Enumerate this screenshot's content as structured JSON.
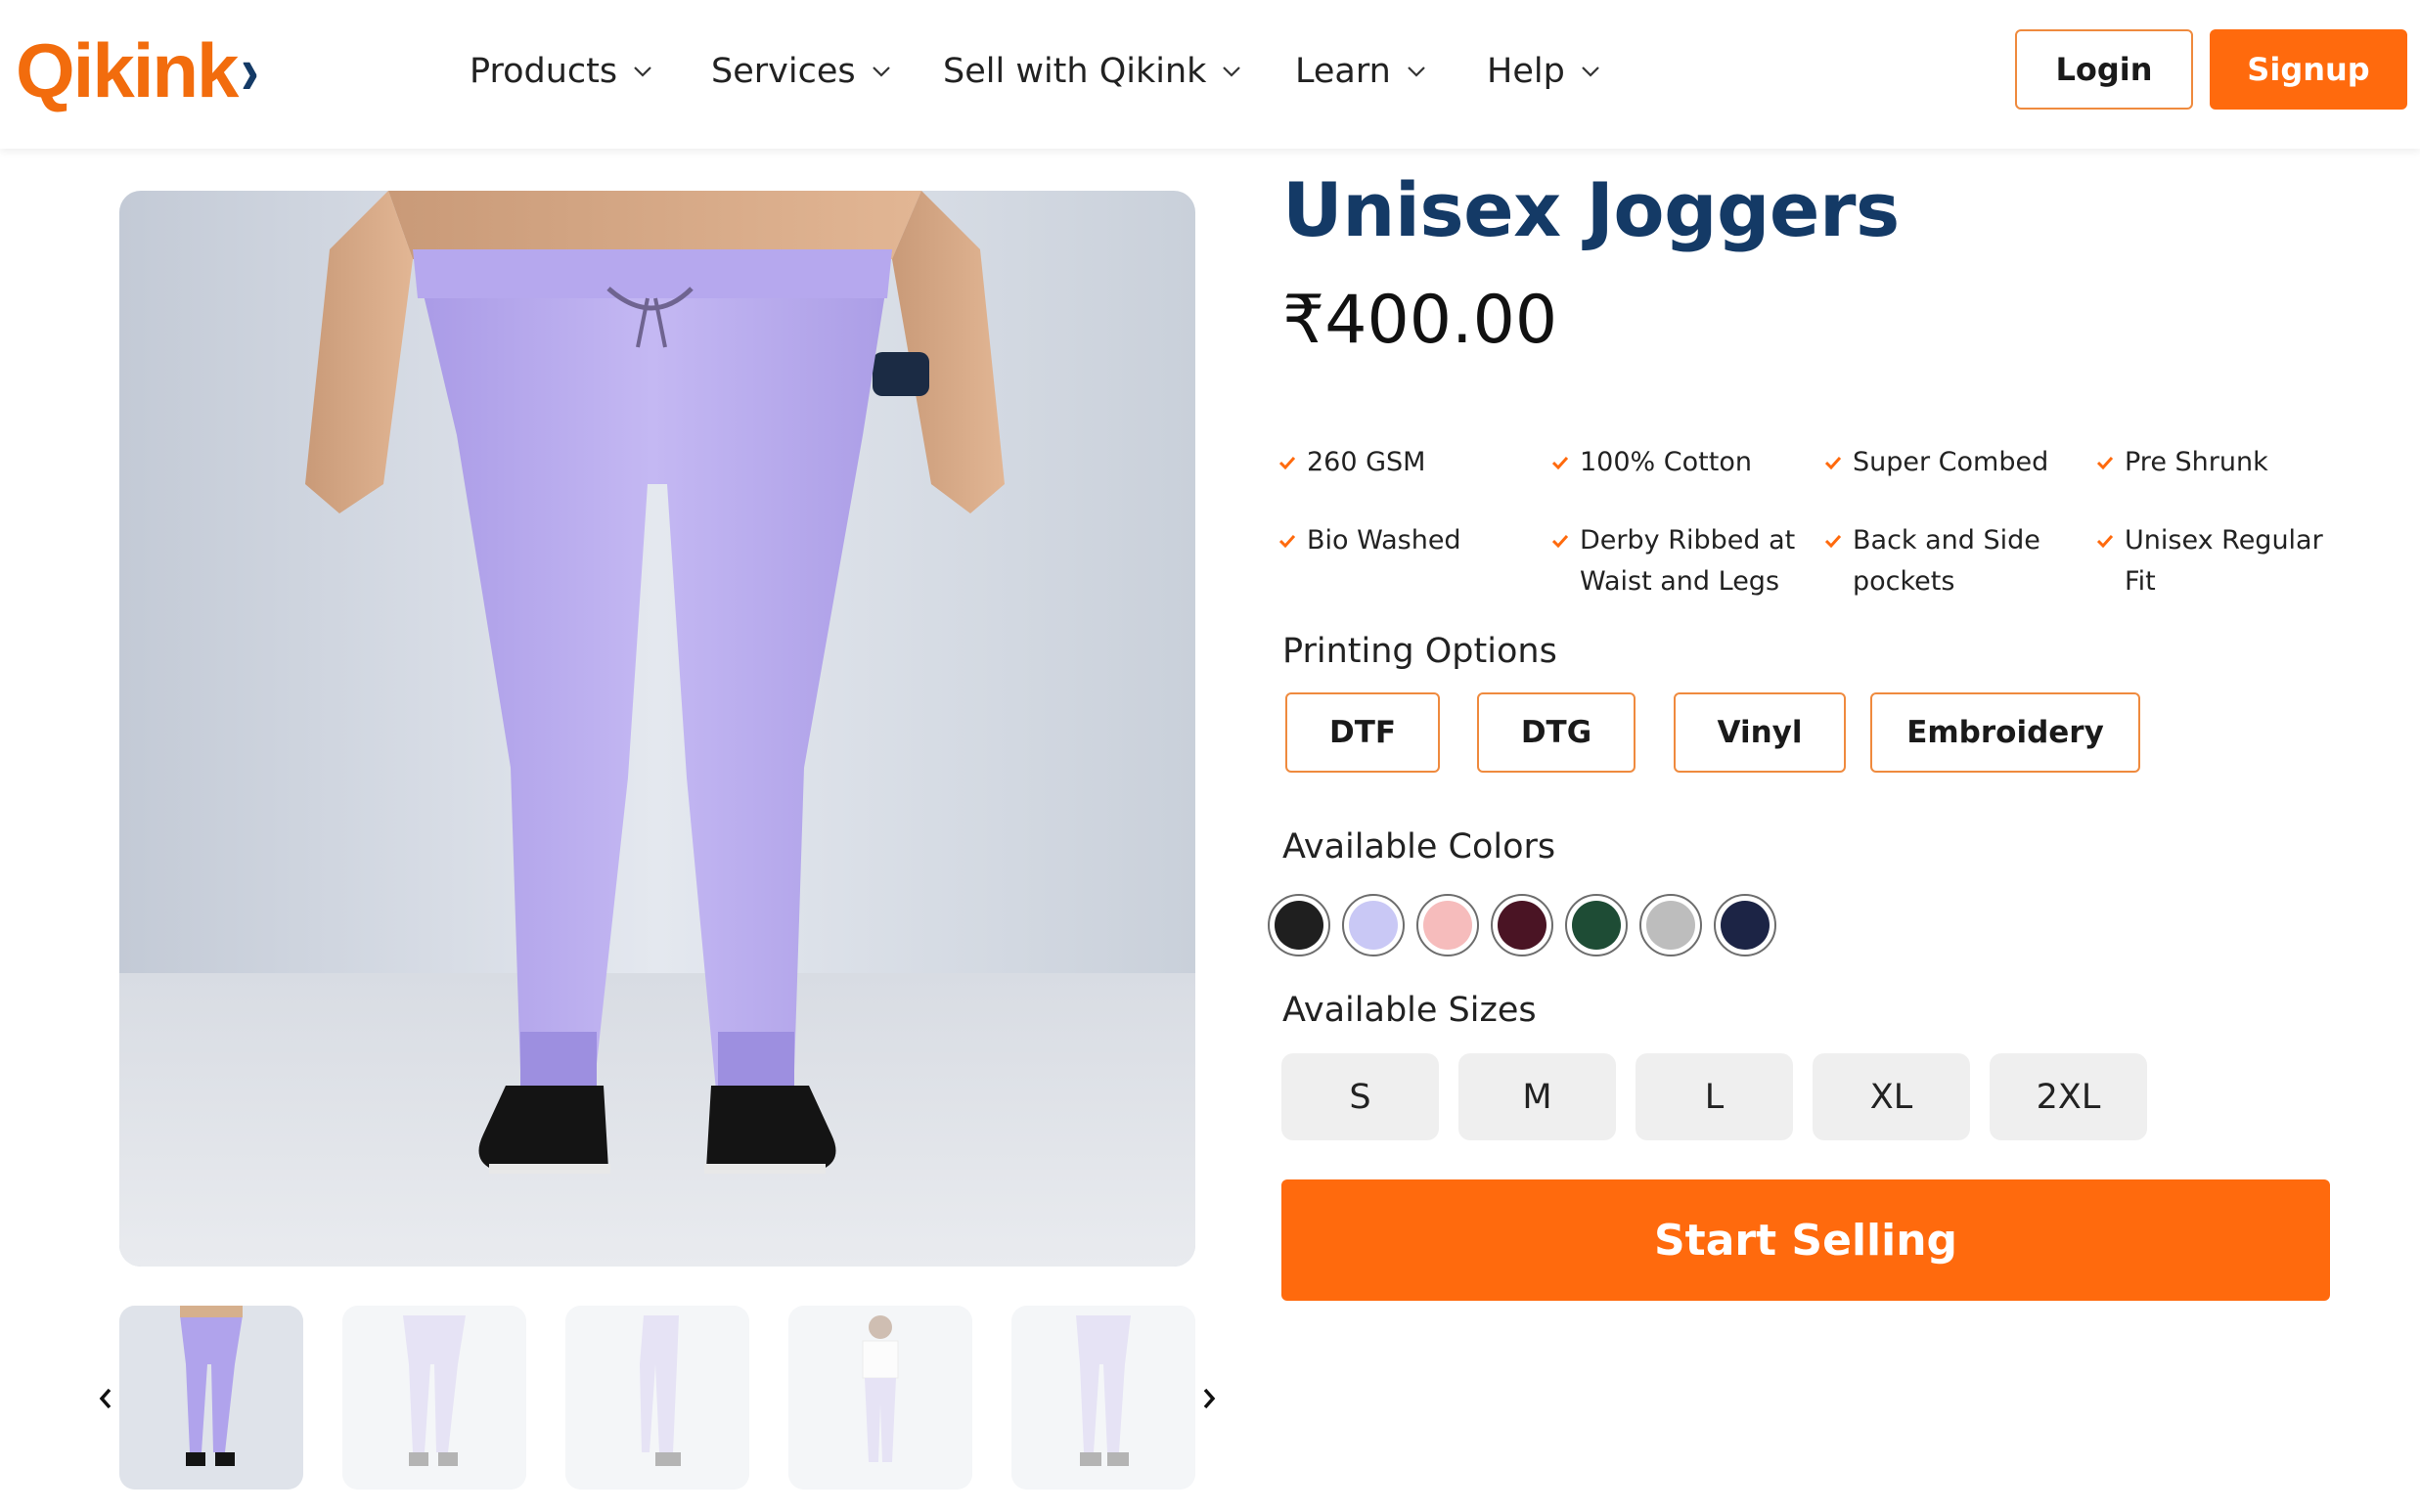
{
  "brand": {
    "name": "Qikink",
    "logo_text": "Qikink",
    "logo_mark": "chevron-mark"
  },
  "nav": {
    "items": [
      {
        "label": "Products"
      },
      {
        "label": "Services"
      },
      {
        "label": "Sell with Qikink"
      },
      {
        "label": "Learn"
      },
      {
        "label": "Help"
      }
    ]
  },
  "auth": {
    "login_label": "Login",
    "signup_label": "Signup"
  },
  "product": {
    "title": "Unisex Joggers",
    "price": "₹400.00",
    "image_alt_icon": "joggers-photo",
    "features": [
      {
        "lines": [
          "260 GSM"
        ]
      },
      {
        "lines": [
          "100% Cotton"
        ]
      },
      {
        "lines": [
          "Super Combed"
        ]
      },
      {
        "lines": [
          "Pre Shrunk"
        ]
      },
      {
        "lines": [
          "Bio Washed"
        ]
      },
      {
        "lines": [
          "Derby Ribbed at",
          "Waist and Legs"
        ]
      },
      {
        "lines": [
          "Back and Side",
          "pockets"
        ]
      },
      {
        "lines": [
          "Unisex Regular",
          "Fit"
        ]
      }
    ],
    "printing_options_label": "Printing Options",
    "printing_options": [
      "DTF",
      "DTG",
      "Vinyl",
      "Embroidery"
    ],
    "colors_label": "Available Colors",
    "colors": [
      "#1f1f1f",
      "#c9c8f5",
      "#f6bcbc",
      "#4a1424",
      "#1e4c35",
      "#bdbdbd",
      "#1c2445"
    ],
    "sizes_label": "Available Sizes",
    "sizes": [
      "S",
      "M",
      "L",
      "XL",
      "2XL"
    ],
    "cta_label": "Start Selling",
    "gallery": {
      "thumbnail_count": 5,
      "selected_index": 0,
      "prev_icon": "chevron-left-icon",
      "next_icon": "chevron-right-icon"
    }
  },
  "colors_theme": {
    "accent": "#ff6a0d",
    "brand_navy": "#143a66",
    "outline_orange": "#ef8a3e",
    "joggers_lavender": "#bfb3ef"
  }
}
